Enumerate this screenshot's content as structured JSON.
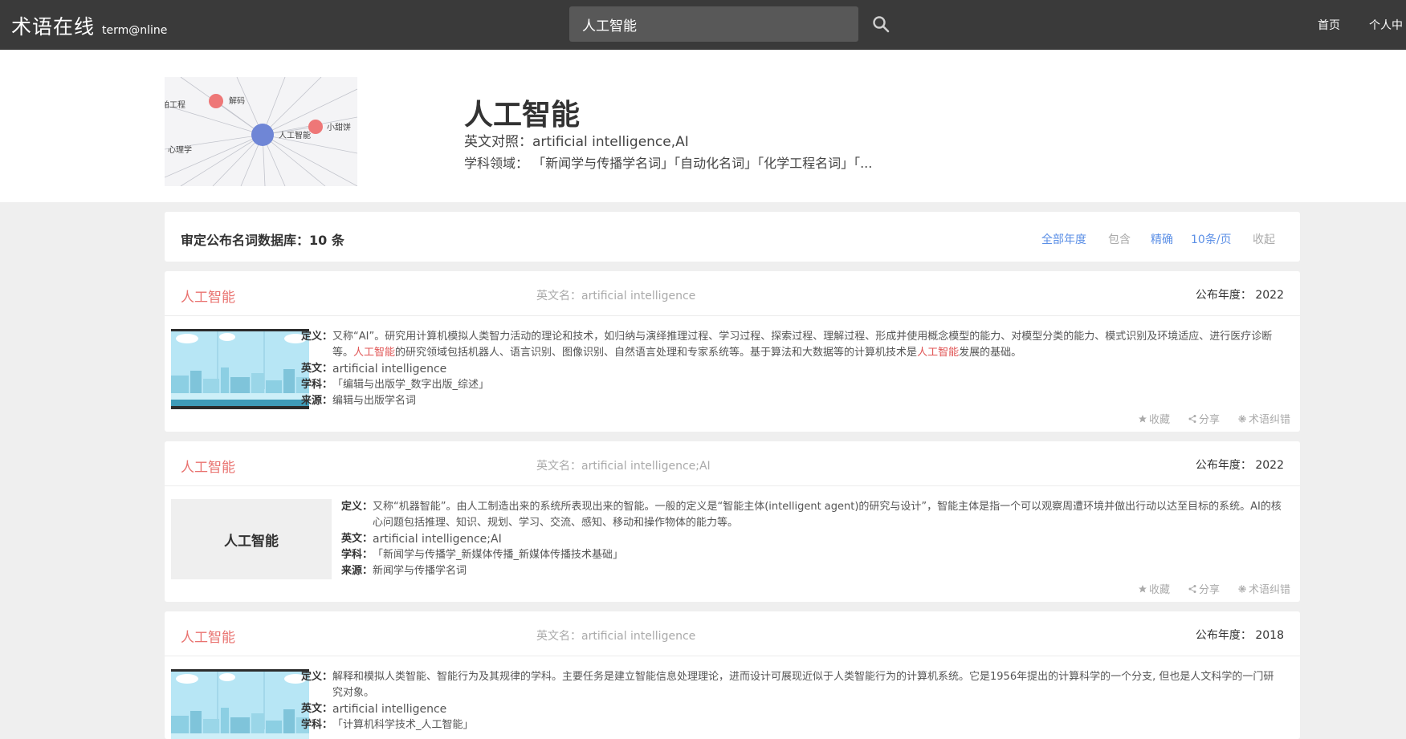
{
  "topbar": {
    "logo_cn": "术语在线",
    "logo_en": "term@nline",
    "search_value": "人工智能",
    "nav_home": "首页",
    "nav_user": "个人中"
  },
  "header": {
    "title": "人工智能",
    "english": "英文对照：artificial intelligence,AI",
    "subjects": "学科领域：  「新闻学与传播学名词」「自动化名词」「化学工程名词」「...",
    "graph": {
      "center": "人工智能",
      "nodes": [
        "解码",
        "小甜饼",
        "船舶工程",
        "心理学"
      ]
    }
  },
  "results": {
    "title": "审定公布名词数据库：10 条",
    "filters": [
      "全部年度",
      "包含",
      "精确",
      "10条/页",
      "收起"
    ]
  },
  "labels": {
    "definition": "定义：",
    "english": "英文：",
    "subject": "学科：",
    "source": "来源："
  },
  "actions": {
    "favorite": "收藏",
    "share": "分享",
    "report": "术语纠错"
  },
  "cards": [
    {
      "term": "人工智能",
      "en_name": "英文名：artificial intelligence",
      "year": "公布年度：  2022",
      "definition_a": "又称“AI”。研究用计算机模拟人类智力活动的理论和技术，如归纳与演绎推理过程、学习过程、探索过程、理解过程、形成并使用概念模型的能力、对模型分类的能力、模式识别及环境适应、进行医疗诊断等。",
      "definition_hl1": "人工智能",
      "definition_b": "的研究领域包括机器人、语言识别、图像识别、自然语言处理和专家系统等。基于算法和大数据等的计算机技术是",
      "definition_hl2": "人工智能",
      "definition_c": "发展的基础。",
      "english": "artificial intelligence",
      "subject": "「编辑与出版学_数字出版_综述」",
      "source": "编辑与出版学名词"
    },
    {
      "term": "人工智能",
      "en_name": "英文名：artificial intelligence;AI",
      "year": "公布年度：  2022",
      "thumb_text": "人工智能",
      "definition": "又称“机器智能”。由人工制造出来的系统所表现出来的智能。一般的定义是“智能主体(intelligent agent)的研究与设计”，智能主体是指一个可以观察周遭环境并做出行动以达至目标的系统。AI的核心问题包括推理、知识、规划、学习、交流、感知、移动和操作物体的能力等。",
      "english": "artificial intelligence;AI",
      "subject": "「新闻学与传播学_新媒体传播_新媒体传播技术基础」",
      "source": "新闻学与传播学名词"
    },
    {
      "term": "人工智能",
      "en_name": "英文名：artificial intelligence",
      "year": "公布年度：  2018",
      "definition": "解释和模拟人类智能、智能行为及其规律的学科。主要任务是建立智能信息处理理论，进而设计可展现近似于人类智能行为的计算机系统。它是1956年提出的计算科学的一个分支, 但也是人文科学的一门研究对象。",
      "english": "artificial intelligence",
      "subject": "「计算机科学技术_人工智能」"
    }
  ]
}
